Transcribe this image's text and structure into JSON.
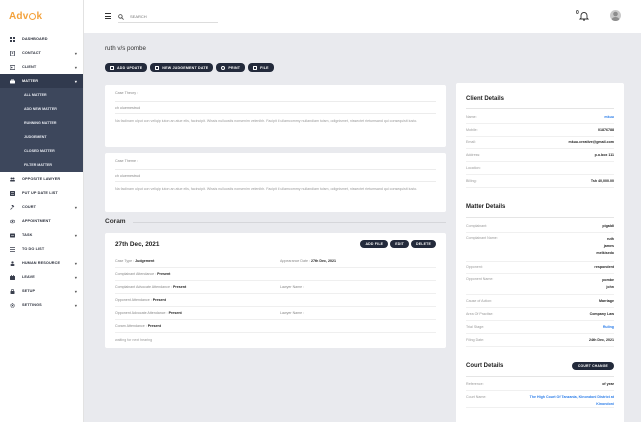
{
  "brand": {
    "name_prefix": "Adv",
    "name_suffix": "k"
  },
  "sidebar": {
    "items": [
      {
        "label": "DASHBOARD",
        "icon": "grid-icon",
        "chevron": false
      },
      {
        "label": "CONTACT",
        "icon": "contact-icon",
        "chevron": true
      },
      {
        "label": "CLIENT",
        "icon": "client-icon",
        "chevron": true
      },
      {
        "label": "MATTER",
        "icon": "briefcase-icon",
        "chevron": true,
        "active": true
      }
    ],
    "matter_sub": [
      "ALL MATTER",
      "ADD NEW MATTER",
      "RUNNING MATTER",
      "JUDGEMENT",
      "CLOSED MATTER",
      "FILTER MATTER"
    ],
    "items_after": [
      {
        "label": "OPPOSITE LAWYER",
        "icon": "users-icon",
        "chevron": false
      },
      {
        "label": "PUT UP DATE LIST",
        "icon": "list-icon",
        "chevron": false
      },
      {
        "label": "COURT",
        "icon": "gavel-icon",
        "chevron": true
      },
      {
        "label": "APPOINTMENT",
        "icon": "eye-icon",
        "chevron": false
      },
      {
        "label": "TASK",
        "icon": "task-icon",
        "chevron": true
      },
      {
        "label": "TO DO LIST",
        "icon": "todo-icon",
        "chevron": false
      },
      {
        "label": "HUMAN RESOURCE",
        "icon": "people-icon",
        "chevron": true
      },
      {
        "label": "LEAVE",
        "icon": "leave-icon",
        "chevron": true
      },
      {
        "label": "SETUP",
        "icon": "lock-icon",
        "chevron": true
      },
      {
        "label": "SETTINGS",
        "icon": "gear-icon",
        "chevron": true
      }
    ]
  },
  "topbar": {
    "search_placeholder": "SEARCH",
    "notification_count": "0"
  },
  "page": {
    "title": "ruth v/s pombe",
    "actions": [
      "ADD UPDATE",
      "NEW JUDGEMENT DATE",
      "PRINT",
      "FILE"
    ]
  },
  "case_theory": {
    "label": "Case Theory :",
    "subtitle": "ch oluemestrud",
    "body": "Na faclinam ulput con veliqip iuton an atue elis, facincipit. Wissis nulluostis nonsenim velenibh. Facipit il ullamcommy nullandiam tuism, odignismet, nissectet rietumsand qui consequisit iusto."
  },
  "case_theme": {
    "label": "Case Theme :",
    "subtitle": "ch oluemestrud",
    "body": "Na faclinam ulput con veliqip iuton an atue elis, facincipit. Wissis nulluostis nonsenim velenibh. Facipit il ullamcommy nullandiam tuism, odignismet, nissectet rietumsand qui consequisit iusto."
  },
  "coram": {
    "title": "Coram",
    "hearing": {
      "date": "27th Dec, 2021",
      "buttons": [
        "ADD FILE",
        "EDIT",
        "DELETE"
      ],
      "case_type_label": "Case Type :",
      "case_type": "Judgement",
      "appearance_label": "Appearance Date :",
      "appearance": "27th Dec, 2021",
      "complainant_att_label": "Complainant Attendance :",
      "complainant_att": "Present",
      "complainant_adv_label": "Complainant Advocate Attendance :",
      "complainant_adv": "Present",
      "lawyer_label_1": "Lawyer Name :",
      "opponent_att_label": "Opponent Attendance :",
      "opponent_att": "Present",
      "opponent_adv_label": "Opponent Advocate Attendance :",
      "opponent_adv": "Present",
      "lawyer_label_2": "Lawyer Name :",
      "coram_att_label": "Coram Attendance :",
      "coram_att": "Present",
      "note": "waiting for next hearing"
    }
  },
  "client_details": {
    "title": "Client Details",
    "rows": [
      {
        "k": "Name:",
        "v": "mkuu",
        "link": true
      },
      {
        "k": "Mobile:",
        "v": "01876788"
      },
      {
        "k": "Email:",
        "v": "mkuu.creative@gmail.com"
      },
      {
        "k": "Address:",
        "v": "p.o.box 111"
      },
      {
        "k": "Location:",
        "v": ""
      },
      {
        "k": "Billing:",
        "v": "Tsh 40,000.00"
      }
    ]
  },
  "matter_details": {
    "title": "Matter Details",
    "complainant_label": "Complainant:",
    "complainant": "pigaldi",
    "complainant_name_label": "Complainant Name:",
    "complainant_names": [
      "ruth",
      "james",
      "melkisedo"
    ],
    "opponent_label": "Opponent:",
    "opponent": "respondent",
    "opponent_name_label": "Opponent Name:",
    "opponent_names": [
      "pombe",
      "john"
    ],
    "rows": [
      {
        "k": "Cause of Action:",
        "v": "Marriage"
      },
      {
        "k": "Area Of Practise:",
        "v": "Company Law"
      },
      {
        "k": "Trial Stage:",
        "v": "Ruling",
        "link": true
      },
      {
        "k": "Filing Date:",
        "v": "24th Dec, 2021"
      }
    ]
  },
  "court_details": {
    "title": "Court Details",
    "button": "COURT CHANGE",
    "reference_label": "Reference:",
    "reference": "of year",
    "court_name_label": "Court Name:",
    "court_name_lines": [
      "The High Court Of Tanzania, Kinondoni District at",
      "Kinondoni"
    ]
  }
}
